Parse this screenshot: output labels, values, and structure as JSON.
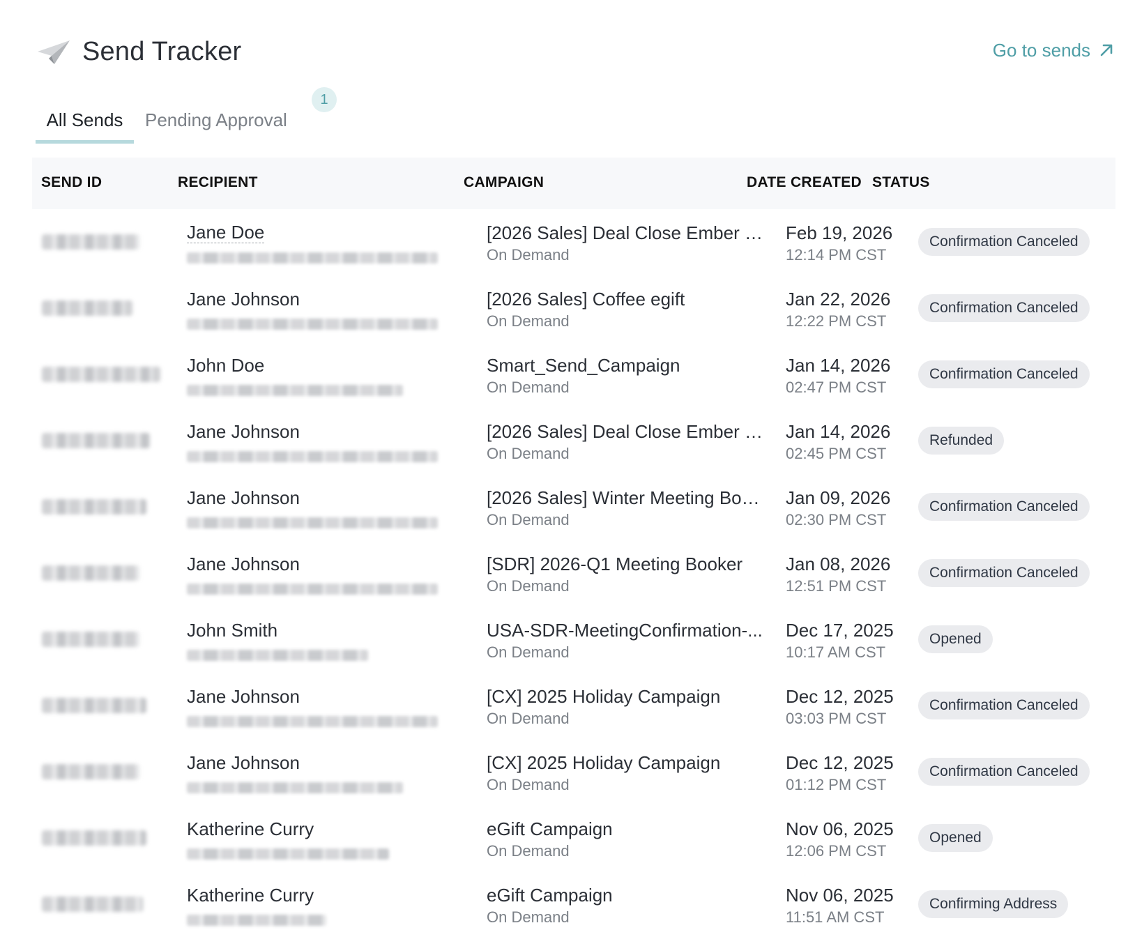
{
  "header": {
    "title": "Send Tracker",
    "goto_label": "Go to sends"
  },
  "tabs": [
    {
      "label": "All Sends",
      "active": true
    },
    {
      "label": "Pending Approval",
      "active": false,
      "badge": "1"
    }
  ],
  "table": {
    "columns": [
      "SEND ID",
      "RECIPIENT",
      "CAMPAIGN",
      "DATE CREATED",
      "STATUS"
    ],
    "rows": [
      {
        "recipient": "Jane Doe",
        "campaign": "[2026 Sales] Deal Close Ember M...",
        "type": "On Demand",
        "date": "Feb 19, 2026",
        "time": "12:14 PM CST",
        "status": "Confirmation Canceled"
      },
      {
        "recipient": "Jane Johnson",
        "campaign": "[2026 Sales] Coffee egift",
        "type": "On Demand",
        "date": "Jan 22, 2026",
        "time": "12:22 PM CST",
        "status": "Confirmation Canceled"
      },
      {
        "recipient": "John Doe",
        "campaign": "Smart_Send_Campaign",
        "type": "On Demand",
        "date": "Jan 14, 2026",
        "time": "02:47 PM CST",
        "status": "Confirmation Canceled"
      },
      {
        "recipient": "Jane Johnson",
        "campaign": "[2026 Sales] Deal Close Ember M...",
        "type": "On Demand",
        "date": "Jan 14, 2026",
        "time": "02:45 PM CST",
        "status": "Refunded"
      },
      {
        "recipient": "Jane Johnson",
        "campaign": "[2026 Sales] Winter Meeting Boo...",
        "type": "On Demand",
        "date": "Jan 09, 2026",
        "time": "02:30 PM CST",
        "status": "Confirmation Canceled"
      },
      {
        "recipient": "Jane Johnson",
        "campaign": "[SDR] 2026-Q1 Meeting Booker",
        "type": "On Demand",
        "date": "Jan 08, 2026",
        "time": "12:51 PM CST",
        "status": "Confirmation Canceled"
      },
      {
        "recipient": "John Smith",
        "campaign": "USA-SDR-MeetingConfirmation-...",
        "type": "On Demand",
        "date": "Dec 17, 2025",
        "time": "10:17 AM CST",
        "status": "Opened"
      },
      {
        "recipient": "Jane Johnson",
        "campaign": "[CX] 2025 Holiday Campaign",
        "type": "On Demand",
        "date": "Dec 12, 2025",
        "time": "03:03 PM CST",
        "status": "Confirmation Canceled"
      },
      {
        "recipient": "Jane Johnson",
        "campaign": "[CX] 2025 Holiday Campaign",
        "type": "On Demand",
        "date": "Dec 12, 2025",
        "time": "01:12 PM CST",
        "status": "Confirmation Canceled"
      },
      {
        "recipient": "Katherine Curry",
        "campaign": "eGift Campaign",
        "type": "On Demand",
        "date": "Nov 06, 2025",
        "time": "12:06 PM CST",
        "status": "Opened"
      },
      {
        "recipient": "Katherine Curry",
        "campaign": "eGift Campaign",
        "type": "On Demand",
        "date": "Nov 06, 2025",
        "time": "11:51 AM CST",
        "status": "Confirming Address"
      }
    ]
  }
}
